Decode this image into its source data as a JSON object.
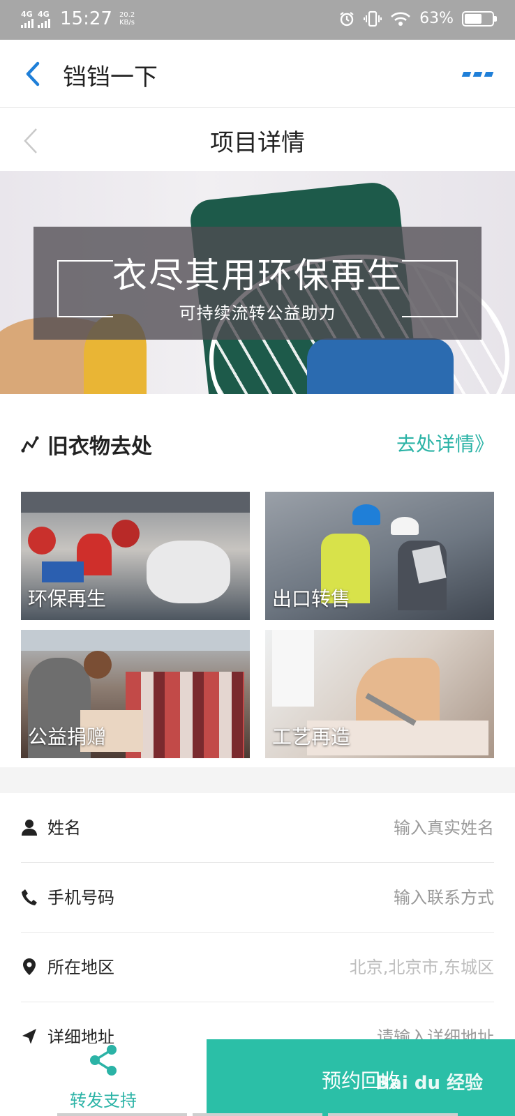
{
  "status_bar": {
    "network1": "4G",
    "network2": "4G",
    "time": "15:27",
    "speed": "20.2\nKB/s",
    "battery": "63%",
    "battery_level": 0.63,
    "icons": [
      "signal-icon",
      "alarm-icon",
      "vibrate-icon",
      "wifi-icon",
      "battery-icon"
    ]
  },
  "app_header": {
    "title": "铛铛一下",
    "back_icon": "chevron-left-icon",
    "more_icon": "more-dots-icon"
  },
  "sub_header": {
    "title": "项目详情"
  },
  "banner": {
    "headline": "衣尽其用环保再生",
    "subline": "可持续流转公益助力"
  },
  "section": {
    "title": "旧衣物去处",
    "link": "去处详情》",
    "tiles": [
      {
        "label": "环保再生"
      },
      {
        "label": "出口转售"
      },
      {
        "label": "公益捐赠"
      },
      {
        "label": "工艺再造"
      }
    ]
  },
  "form": {
    "rows": [
      {
        "label": "姓名",
        "value": "输入真实姓名",
        "icon": "person-icon"
      },
      {
        "label": "手机号码",
        "value": "输入联系方式",
        "icon": "phone-icon"
      },
      {
        "label": "所在地区",
        "value": "北京,北京市,东城区",
        "icon": "location-icon"
      },
      {
        "label": "详细地址",
        "value": "请输入详细地址",
        "icon": "navigation-icon"
      }
    ]
  },
  "bottom_bar": {
    "share_label": "转发支持",
    "book_label": "预约回收",
    "watermark": "Bai du 经验"
  },
  "colors": {
    "accent": "#2bbfa7",
    "link": "#2bb3a6",
    "header_blue": "#1f7fd8",
    "status_bar": "#a7a7a7"
  }
}
